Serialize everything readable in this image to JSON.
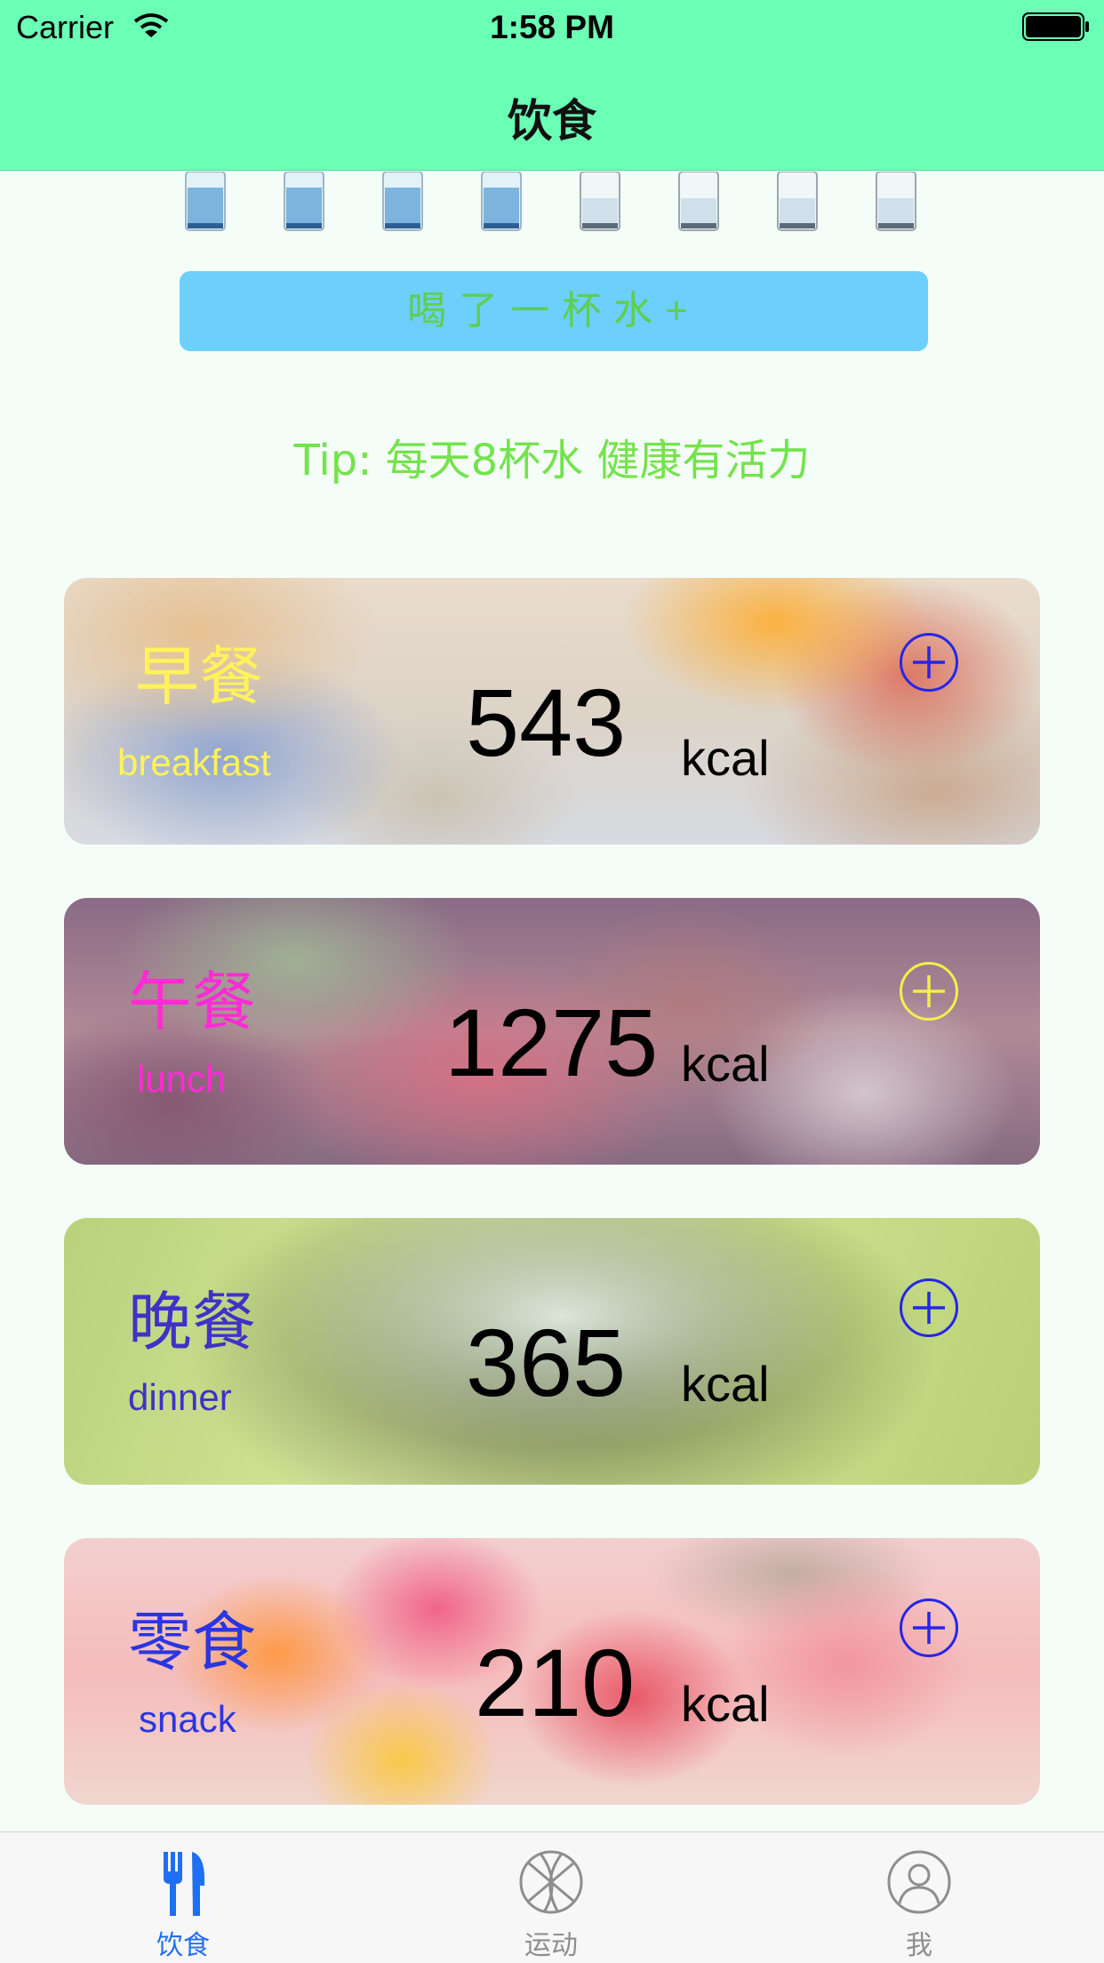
{
  "status_bar": {
    "carrier": "Carrier",
    "time": "1:58 PM"
  },
  "nav": {
    "title": "饮食"
  },
  "water": {
    "glasses_total": 8,
    "glasses_filled": 4,
    "button_label": "喝了一杯水+",
    "tip": "Tip: 每天8杯水 健康有活力"
  },
  "meals": [
    {
      "name_cn": "早餐",
      "name_en": "breakfast",
      "kcal": "543",
      "unit": "kcal",
      "label_color": "#fff25a",
      "add_color": "#2626e8"
    },
    {
      "name_cn": "午餐",
      "name_en": "lunch",
      "kcal": "1275",
      "unit": "kcal",
      "label_color": "#ff2bd6",
      "add_color": "#f2f04a"
    },
    {
      "name_cn": "晚餐",
      "name_en": "dinner",
      "kcal": "365",
      "unit": "kcal",
      "label_color": "#3f32c8",
      "add_color": "#2626e8"
    },
    {
      "name_cn": "零食",
      "name_en": "snack",
      "kcal": "210",
      "unit": "kcal",
      "label_color": "#2a36e0",
      "add_color": "#2626e8"
    }
  ],
  "tabs": [
    {
      "label": "饮食",
      "icon": "fork-knife-icon",
      "active": true
    },
    {
      "label": "运动",
      "icon": "basketball-icon",
      "active": false
    },
    {
      "label": "我",
      "icon": "person-icon",
      "active": false
    }
  ],
  "colors": {
    "nav_bg": "#6bffb6",
    "button_bg": "#6ccffc",
    "tip": "#74e34c",
    "tab_active": "#1f6ff2",
    "tab_inactive": "#8e8e8e"
  }
}
